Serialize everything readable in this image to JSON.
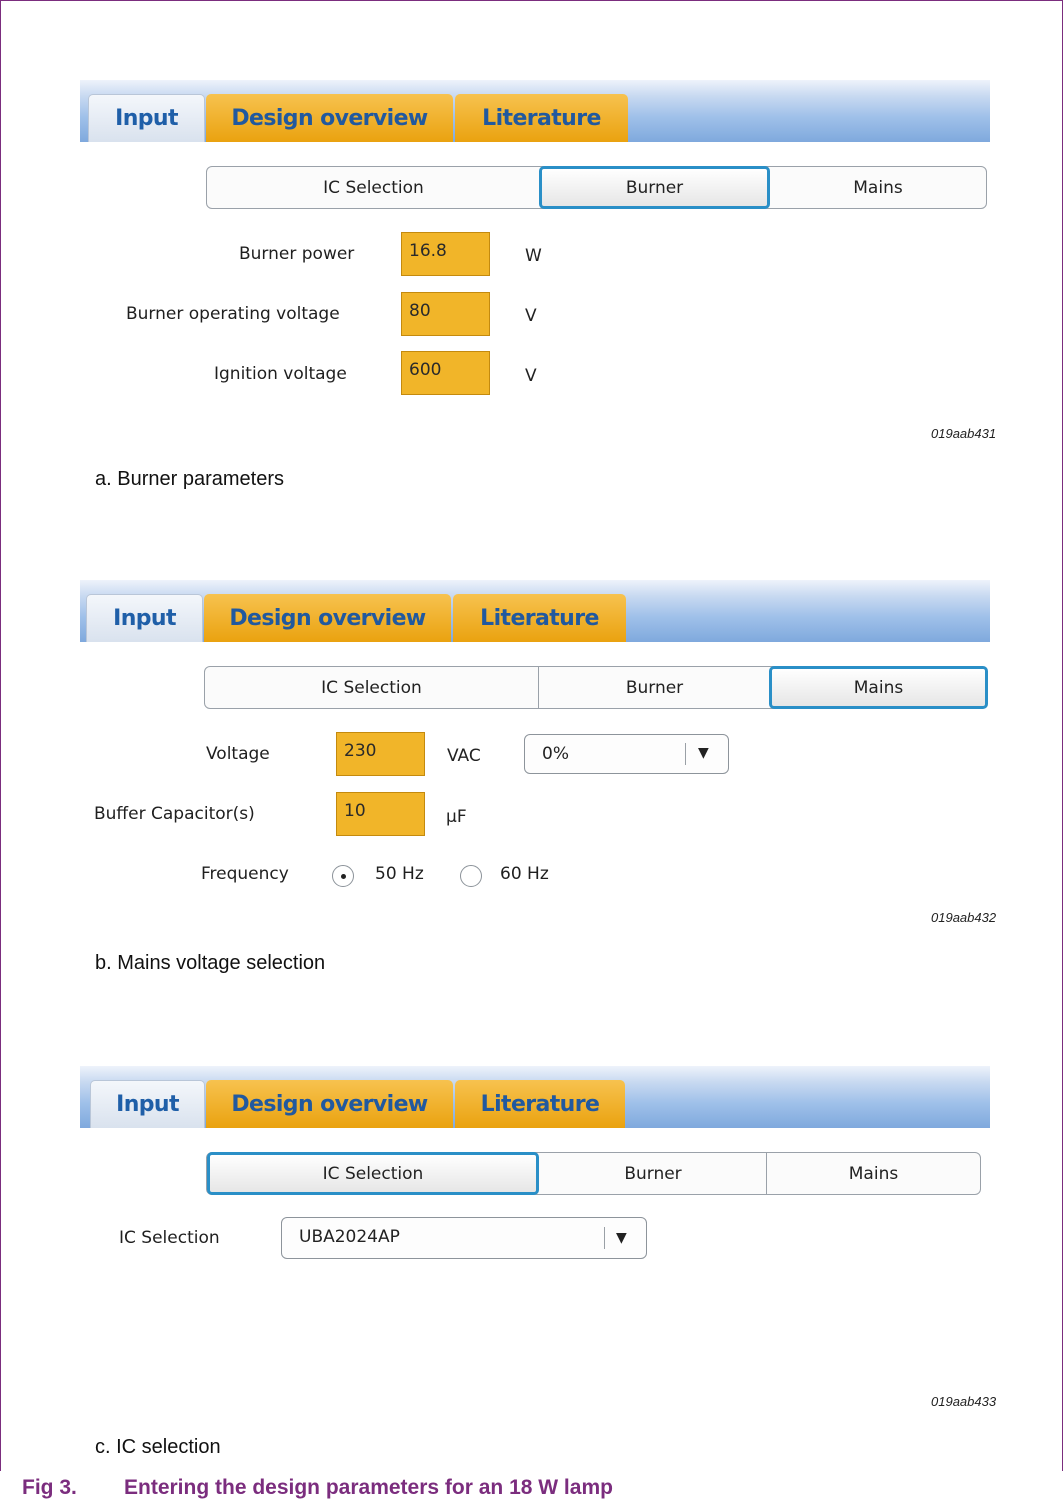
{
  "panels": [
    {
      "tabs": [
        "Input",
        "Design overview",
        "Literature"
      ],
      "segments": [
        "IC Selection",
        "Burner",
        "Mains"
      ],
      "selected_segment": "Burner",
      "fields": [
        {
          "label": "Burner power",
          "value": "16.8",
          "unit": "W"
        },
        {
          "label": "Burner operating voltage",
          "value": "80",
          "unit": "V"
        },
        {
          "label": "Ignition voltage",
          "value": "600",
          "unit": "V"
        }
      ],
      "code": "019aab431",
      "caption": "a.  Burner parameters"
    },
    {
      "tabs": [
        "Input",
        "Design overview",
        "Literature"
      ],
      "segments": [
        "IC Selection",
        "Burner",
        "Mains"
      ],
      "selected_segment": "Mains",
      "voltage": {
        "label": "Voltage",
        "value": "230",
        "unit": "VAC",
        "tolerance": "0%"
      },
      "buffer": {
        "label": "Buffer Capacitor(s)",
        "value": "10",
        "unit": "µF"
      },
      "frequency": {
        "label": "Frequency",
        "options": [
          "50 Hz",
          "60 Hz"
        ],
        "selected": "50 Hz"
      },
      "code": "019aab432",
      "caption": "b.  Mains voltage selection"
    },
    {
      "tabs": [
        "Input",
        "Design overview",
        "Literature"
      ],
      "segments": [
        "IC Selection",
        "Burner",
        "Mains"
      ],
      "selected_segment": "IC Selection",
      "ic": {
        "label": "IC Selection",
        "value": "UBA2024AP"
      },
      "code": "019aab433",
      "caption": "c.  IC selection"
    }
  ],
  "figure": {
    "number": "Fig 3.",
    "title": "Entering the design parameters for an 18 W lamp"
  },
  "colors": {
    "accent_purple": "#7b2d7e",
    "field_orange": "#f1b529",
    "selection_blue": "#2a8fc7"
  }
}
